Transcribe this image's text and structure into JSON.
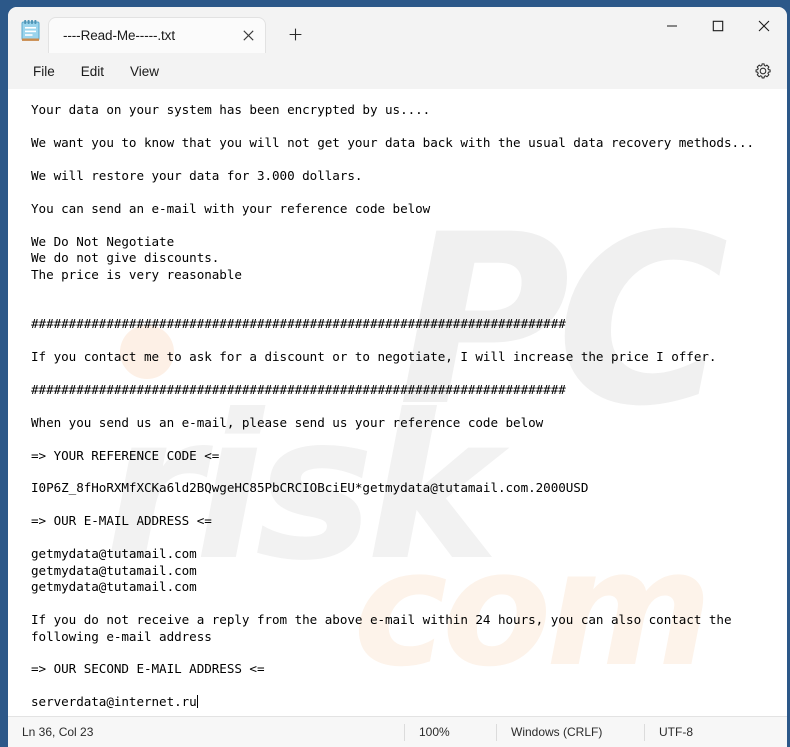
{
  "window": {
    "app_icon": "notepad-icon",
    "controls": {
      "minimize": "minimize-icon",
      "maximize": "maximize-icon",
      "close": "close-icon"
    }
  },
  "tabs": [
    {
      "title": "----Read-Me-----.txt",
      "close_label": "close-tab-icon",
      "active": true
    }
  ],
  "new_tab": {
    "label": "+"
  },
  "menu": {
    "items": [
      {
        "label": "File"
      },
      {
        "label": "Edit"
      },
      {
        "label": "View"
      }
    ],
    "settings_icon": "gear-icon"
  },
  "watermark": {
    "pc": "PC",
    "risk": "risk",
    "com": "com"
  },
  "document": {
    "content": "Your data on your system has been encrypted by us....\n\nWe want you to know that you will not get your data back with the usual data recovery methods...\n\nWe will restore your data for 3.000 dollars.\n\nYou can send an e-mail with your reference code below\n\nWe Do Not Negotiate\nWe do not give discounts.\nThe price is very reasonable\n\n\n#######################################################################\n\nIf you contact me to ask for a discount or to negotiate, I will increase the price I offer.\n\n#######################################################################\n\nWhen you send us an e-mail, please send us your reference code below\n\n=> YOUR REFERENCE CODE <=\n\nI0P6Z_8fHoRXMfXCKa6ld2BQwgeHC85PbCRCIOBciEU*getmydata@tutamail.com.2000USD\n\n=> OUR E-MAIL ADDRESS <=\n\ngetmydata@tutamail.com\ngetmydata@tutamail.com\ngetmydata@tutamail.com\n\nIf you do not receive a reply from the above e-mail within 24 hours, you can also contact the\nfollowing e-mail address\n\n=> OUR SECOND E-MAIL ADDRESS <=\n\nserverdata@internet.ru"
  },
  "status_bar": {
    "position": "Ln 36, Col 23",
    "zoom": "100%",
    "line_ending": "Windows (CRLF)",
    "encoding": "UTF-8"
  },
  "colors": {
    "desktop": "#2c5889",
    "titlebar": "#f3f3f3",
    "editor_bg": "#ffffff",
    "text": "#000000",
    "statusbar": "#f7f7f7"
  }
}
